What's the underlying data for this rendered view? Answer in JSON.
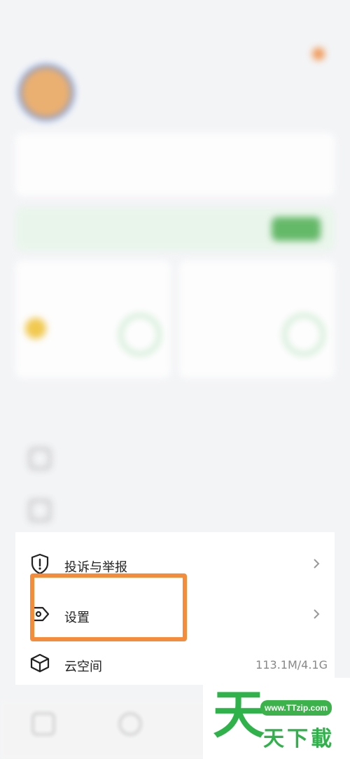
{
  "menu": {
    "items": [
      {
        "label": "投诉与举报",
        "icon": "shield-alert-icon"
      },
      {
        "label": "设置",
        "icon": "settings-tag-icon"
      },
      {
        "label": "云空间",
        "icon": "cube-icon",
        "meta": "113.1M/4.1G"
      }
    ]
  },
  "watermark": {
    "big_char": "天",
    "url": "www.TTzip.com",
    "text": "天下載"
  },
  "colors": {
    "highlight": "#f68b3a",
    "watermark_green": "#2fb24a"
  }
}
